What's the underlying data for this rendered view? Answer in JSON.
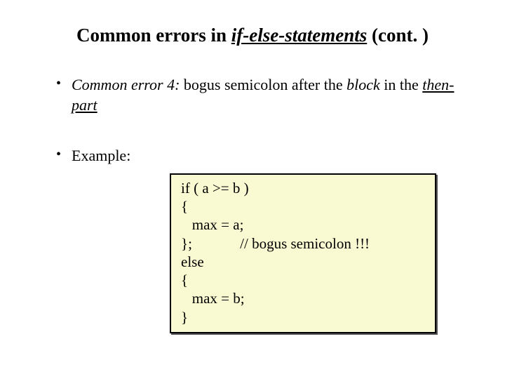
{
  "title": {
    "prefix": "Common errors in ",
    "ital_underlined": "if-else-statements",
    "suffix": " (cont. )"
  },
  "bullet1": {
    "lead_ital": "Common error 4:",
    "mid_plain": " bogus semicolon after the ",
    "mid_ital": "block",
    "mid_plain2": " in the ",
    "end_ital_under": "then-part"
  },
  "bullet2": {
    "label": "Example:"
  },
  "code": {
    "l1": "if ( a >= b )",
    "l2": "{",
    "l3": "   max = a;",
    "l4": "};             // bogus semicolon !!!",
    "l5": "else",
    "l6": "{",
    "l7": "   max = b;",
    "l8": "}"
  }
}
